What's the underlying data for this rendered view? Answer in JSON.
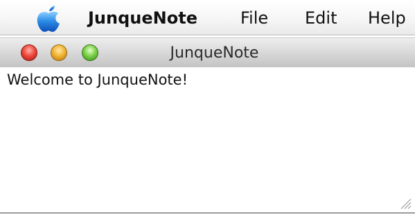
{
  "menubar": {
    "apple_icon": "apple-logo-icon",
    "app_name": "JunqueNote",
    "items": [
      {
        "label": "File"
      },
      {
        "label": "Edit"
      },
      {
        "label": "Help"
      }
    ]
  },
  "window": {
    "title": "JunqueNote",
    "controls": {
      "close_color": "#ee4b3e",
      "minimize_color": "#f3b536",
      "zoom_color": "#7fd14a"
    }
  },
  "document": {
    "text": "Welcome to JunqueNote!"
  },
  "icons": {
    "resize": "resize-grip-icon"
  }
}
